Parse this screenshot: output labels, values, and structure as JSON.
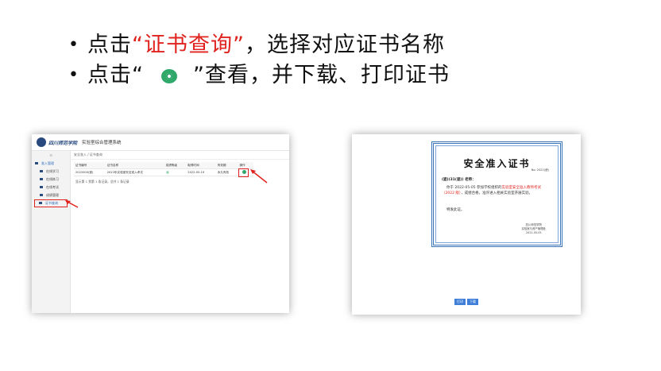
{
  "instructions": {
    "line1": {
      "prefix": "点击",
      "highlight": "“证书查询”",
      "suffix": "，选择对应证书名称"
    },
    "line2": {
      "prefix": "点击“",
      "suffix": "”查看，并下载、打印证书"
    },
    "bullet": "•"
  },
  "left_screenshot": {
    "logo_text": "四川师范学院",
    "system_title": "实验室综合管理系统",
    "sidebar_toggle": "☰",
    "sidebar": [
      {
        "label": "准入管理",
        "type": "group"
      },
      {
        "label": "在线学习",
        "type": "item"
      },
      {
        "label": "在线练习",
        "type": "item"
      },
      {
        "label": "在线考试",
        "type": "item"
      },
      {
        "label": "成绩管理",
        "type": "item"
      },
      {
        "label": "证书查询",
        "type": "item",
        "active": true
      }
    ],
    "breadcrumb": "安全准入 / 证书查询",
    "table": {
      "headers": [
        "证书编号",
        "证书名称",
        "成绩等级",
        "取得时间",
        "有效期",
        "操作"
      ],
      "rows": [
        {
          "number": "2022000(遮)",
          "name": "2022年实验室安全准入考试",
          "grade": "A",
          "date": "2022-05-19",
          "validity": "永久有效"
        }
      ]
    },
    "pager": "显示第 1 到第 1 条记录，总共 1 条记录"
  },
  "certificate": {
    "title": "安全准入证书",
    "number": "No: 2022(遮)",
    "recipient": "(遮)(31(遮)) 老师：",
    "body_prefix": "你于 2022-05-05 参加学校组织的",
    "body_highlight": "实验室安全准入教师考试（2022 版）",
    "body_suffix": "，成绩合格，准许进入相关实验室开展实验。",
    "issue": "特发此证。",
    "school_line1": "四川师范学院",
    "school_line2": "实验室与资产管理处",
    "date": "2022-05-05",
    "buttons": [
      "打印",
      "下载"
    ]
  },
  "colors": {
    "highlight": "#e0231f",
    "accent_blue": "#3a74b8",
    "eye_green": "#2fa86a"
  }
}
